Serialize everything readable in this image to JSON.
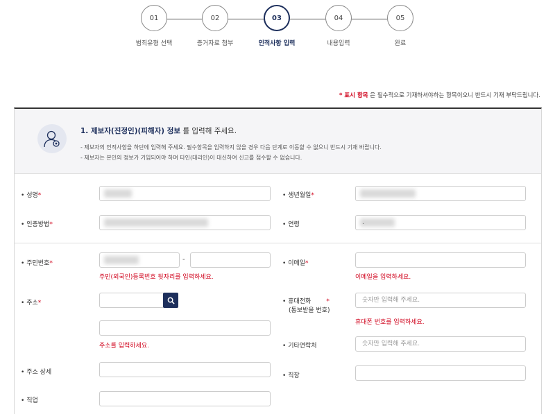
{
  "steps": [
    {
      "num": "01",
      "label": "범죄유형 선택"
    },
    {
      "num": "02",
      "label": "증거자료 첨부"
    },
    {
      "num": "03",
      "label": "인적사항 입력"
    },
    {
      "num": "04",
      "label": "내용입력"
    },
    {
      "num": "05",
      "label": "완료"
    }
  ],
  "active_step": 3,
  "notice": {
    "mark": "* 표시 항목",
    "text": " 은 필수적으로 기재하셔야하는 항목이오니 반드시 기재 부탁드립니다."
  },
  "section": {
    "title_bold": "1. 제보자(진정인)(피해자) 정보",
    "title_rest": " 를 입력해 주세요.",
    "desc1": "-  제보자의 인적사항을 하단에 입력해 주세요. 필수항목을 입력하지 않을 경우 다음 단계로 이동할 수 없으니 반드시 기재 바랍니다.",
    "desc2": "-  제보자는 본인의 정보가 기입되어야 하며 타인(대리인)이 대신하여 신고를 접수할 수 없습니다."
  },
  "fields": {
    "name": {
      "label": "성명",
      "req": "*"
    },
    "birth": {
      "label": "생년월일",
      "req": "*"
    },
    "auth": {
      "label": "인증방법",
      "req": "*"
    },
    "age": {
      "label": "연령",
      "value": "."
    },
    "rrn": {
      "label": "주민번호",
      "req": "*",
      "sep": "-",
      "error": "주민(외국인)등록번호 뒷자리를 입력하세요."
    },
    "email": {
      "label": "이메일",
      "req": "*",
      "error": "이메일을 입력하세요."
    },
    "address": {
      "label": "주소",
      "req": "*",
      "error": "주소를 입력하세요."
    },
    "mobile": {
      "label1": "휴대전화",
      "label2": "(통보받을 번호)",
      "req": "*",
      "placeholder": "숫자만 입력해 주세요.",
      "error": "휴대폰 번호를 입력하세요."
    },
    "other_contact": {
      "label": "기타연락처",
      "placeholder": "숫자만 입력해 주세요."
    },
    "address_detail": {
      "label": "주소 상세"
    },
    "workplace": {
      "label": "직장"
    },
    "job": {
      "label": "직업"
    }
  },
  "bullet": "•",
  "colors": {
    "accent": "#1d2f5c",
    "required": "#d0021b"
  }
}
